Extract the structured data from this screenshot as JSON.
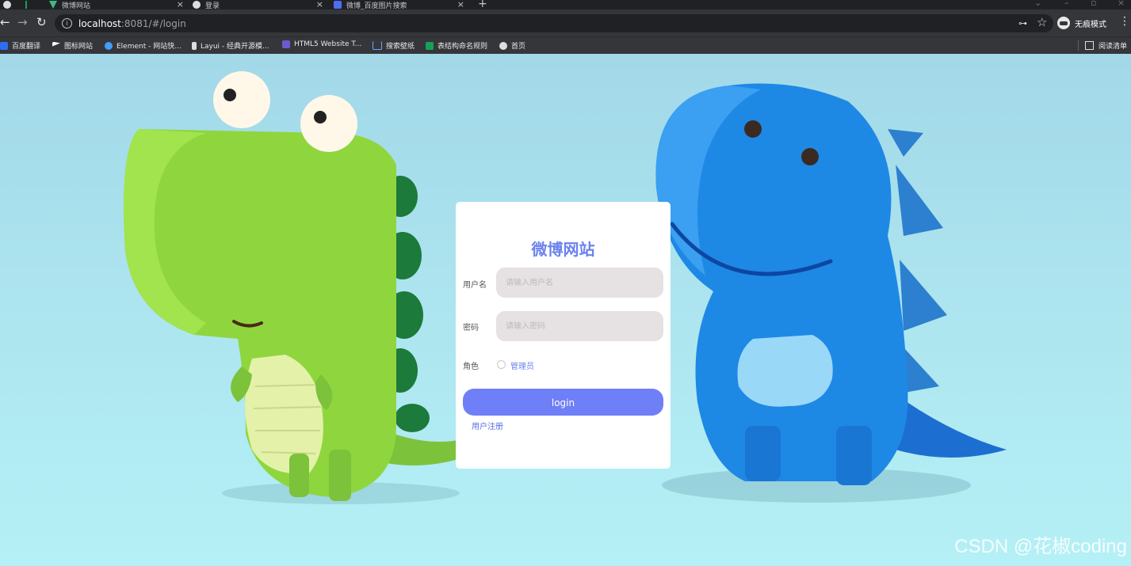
{
  "tabs": [
    {
      "title": "",
      "closable": false
    },
    {
      "title": "微博网站",
      "closable": true
    },
    {
      "title": "登录",
      "closable": true
    },
    {
      "title": "微博_百度图片搜索",
      "closable": true
    }
  ],
  "address": {
    "host": "localhost",
    "path": ":8081/#/login"
  },
  "incognito_label": "无痕模式",
  "bookmarks": [
    "百度翻译",
    "图标网站",
    "Element - 网站快...",
    "Layui - 经典开源模...",
    "HTML5 Website T...",
    "搜索壁纸",
    "表结构命名规则",
    "首页"
  ],
  "reading_list": "阅读清单",
  "login": {
    "title": "微博网站",
    "username_label": "用户名",
    "username_placeholder": "请输入用户名",
    "password_label": "密码",
    "password_placeholder": "请输入密码",
    "role_label": "角色",
    "role_option": "管理员",
    "button_label": "login",
    "register_link": "用户注册"
  },
  "watermark": "CSDN @花椒coding",
  "colors": {
    "accent": "#6b82ee",
    "button": "#6f7ff7",
    "input_bg": "#e6e1e3",
    "page_bg": "#aee3ee"
  }
}
